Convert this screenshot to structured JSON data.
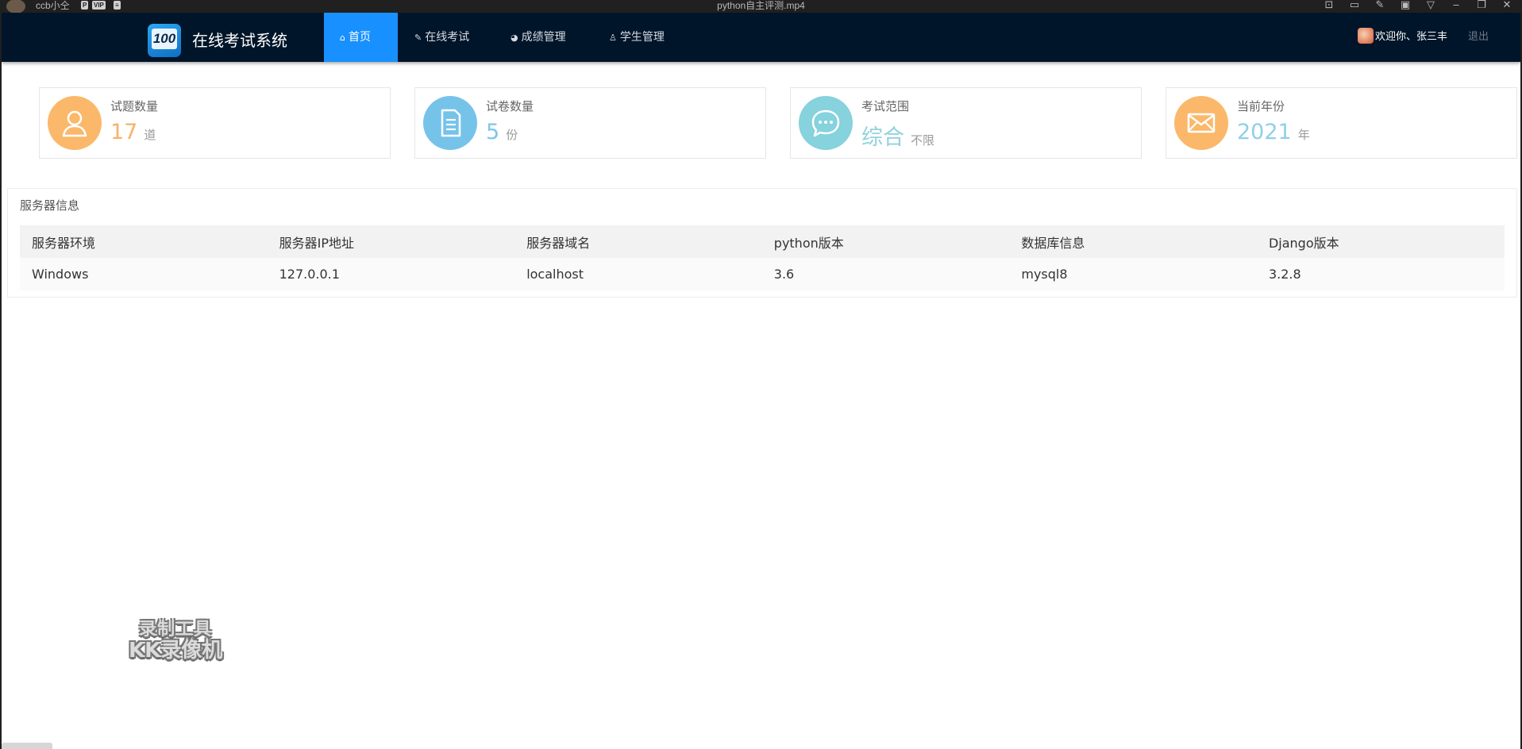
{
  "player": {
    "user": "ccb小仝",
    "badges": [
      "P",
      "VIP",
      "≡"
    ],
    "file_title": "python自主评测.mp4",
    "icons": [
      "gamepad-icon",
      "save-icon",
      "brush-icon",
      "window-icon",
      "dropdown-icon",
      "minimize-icon",
      "restore-icon",
      "close-icon"
    ],
    "icon_glyphs": [
      "⊡",
      "▭",
      "✎",
      "▣",
      "▽",
      "–",
      "❐",
      "✕"
    ]
  },
  "navbar": {
    "logo_text": "100",
    "title": "在线考试系统",
    "items": [
      {
        "label": "首页",
        "icon": "⌂",
        "icon_name": "home-icon",
        "active": true
      },
      {
        "label": "在线考试",
        "icon": "✎",
        "icon_name": "edit-icon",
        "active": false
      },
      {
        "label": "成绩管理",
        "icon": "◕",
        "icon_name": "chart-icon",
        "active": false
      },
      {
        "label": "学生管理",
        "icon": "♙",
        "icon_name": "person-icon",
        "active": false
      }
    ],
    "welcome": "欢迎你、张三丰",
    "logout": "退出"
  },
  "stats": [
    {
      "label": "试题数量",
      "value": "17",
      "unit": "道",
      "icon": "user-icon",
      "circle_color": "#fbb86a",
      "value_color": "#f7b267"
    },
    {
      "label": "试卷数量",
      "value": "5",
      "unit": "份",
      "icon": "document-icon",
      "circle_color": "#76c3ea",
      "value_color": "#7ec6e8"
    },
    {
      "label": "考试范围",
      "value": "综合",
      "unit": "不限",
      "icon": "chat-icon",
      "circle_color": "#86d2dd",
      "value_color": "#92d2de"
    },
    {
      "label": "当前年份",
      "value": "2021",
      "unit": "年",
      "icon": "mail-icon",
      "circle_color": "#fbb86a",
      "value_color": "#8fd0e6"
    }
  ],
  "server": {
    "title": "服务器信息",
    "columns": [
      "服务器环境",
      "服务器IP地址",
      "服务器域名",
      "python版本",
      "数据库信息",
      "Django版本"
    ],
    "rows": [
      [
        "Windows",
        "127.0.0.1",
        "localhost",
        "3.6",
        "mysql8",
        "3.2.8"
      ]
    ]
  },
  "watermark": {
    "line1": "录制工具",
    "line2": "KK录像机"
  }
}
